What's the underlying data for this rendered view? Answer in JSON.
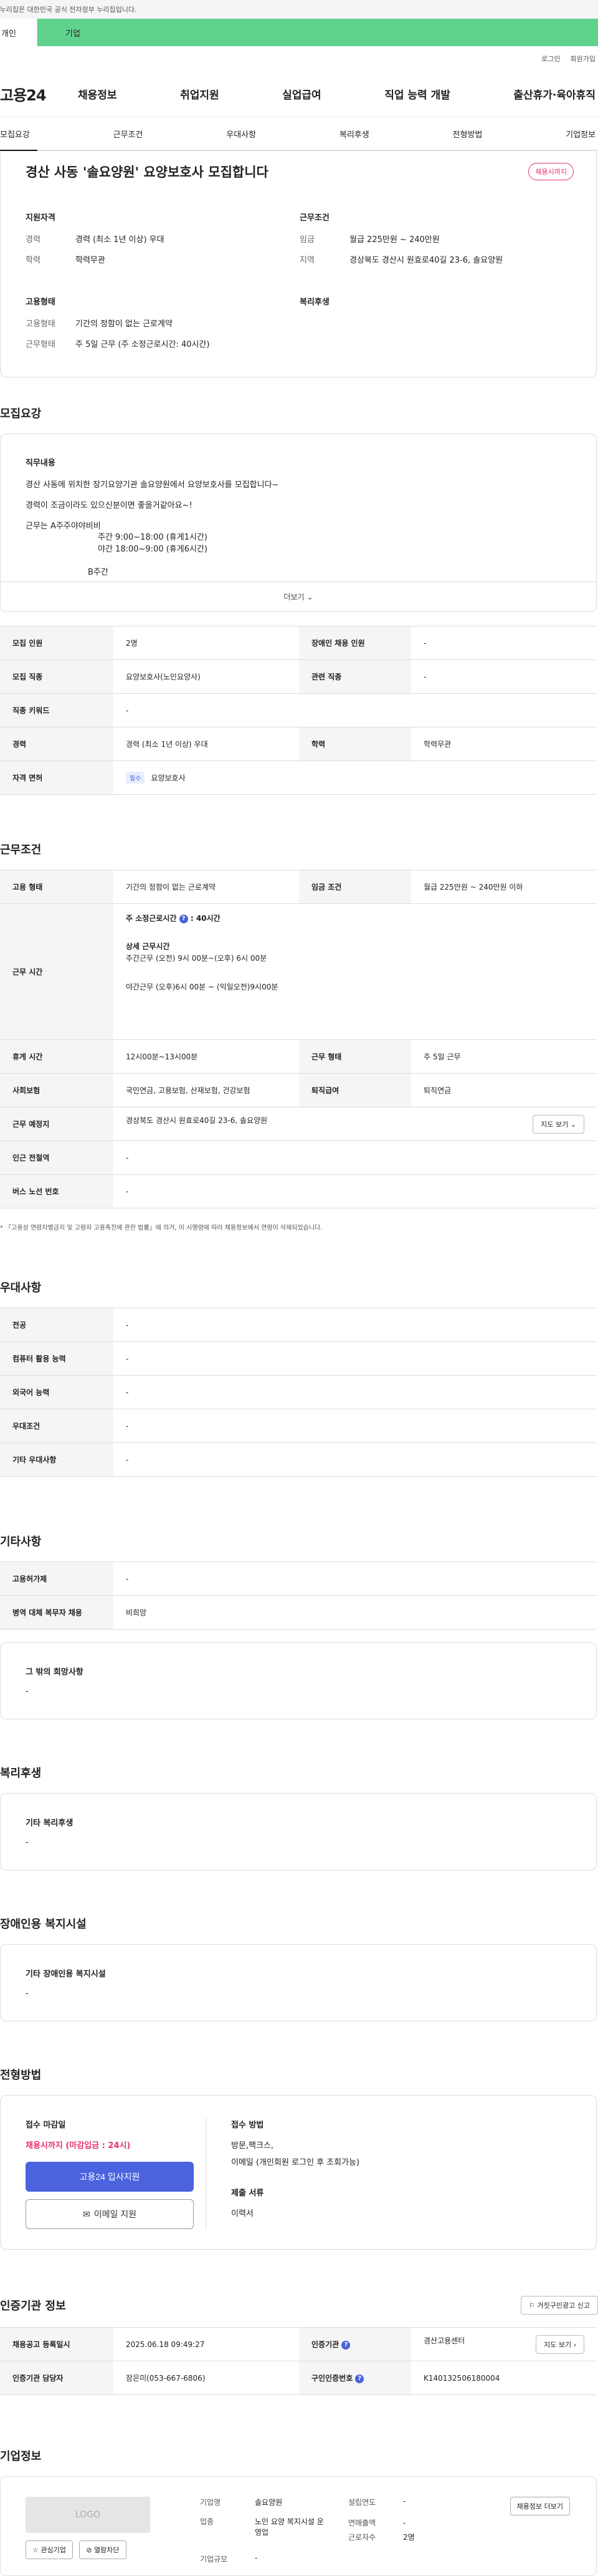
{
  "gov_banner": "이 누리집은 대한민국 공식 전자정부 누리집입니다.",
  "tabs": {
    "personal": "개인",
    "company": "기업"
  },
  "util": {
    "login": "로그인",
    "join": "회원가입"
  },
  "logo": "고용24",
  "gnb": [
    "채용정보",
    "취업지원",
    "실업급여",
    "직업 능력 개발",
    "출산휴가·육아휴직"
  ],
  "subnav": [
    "모집요강",
    "근무조건",
    "우대사항",
    "복리후생",
    "전형방법",
    "기업정보"
  ],
  "summary": {
    "title": "경산 사동 '솔요양원' 요양보호사 모집합니다",
    "badge": "채용시까지",
    "qual_title": "지원자격",
    "career_k": "경력",
    "career_v": "경력 (최소 1년 이상) 우대",
    "edu_k": "학력",
    "edu_v": "학력무관",
    "work_title": "근무조건",
    "wage_k": "임금",
    "wage_v": "월급 225만원 ~ 240만원",
    "area_k": "지역",
    "area_v": "경상북도 경산시 원효로40길 23-6, 솔요양원",
    "emp_title": "고용형태",
    "emptype_k": "고용형태",
    "emptype_v": "기간의 정함이 없는 근로계약",
    "worktype_k": "근무형태",
    "worktype_v": "주 5일 근무 (주 소정근로시간: 40시간)",
    "welfare_title": "복리후생"
  },
  "recruit": {
    "heading": "모집요강",
    "label": "직무내용",
    "line1": "경산 사동에 위치한   장기요양기관   솔요양원에서  요양보호사를 모집합니다~",
    "line2": "경력이 조금이라도 있으신분이면 좋을거같아요~!",
    "line3": "근무는    A주주야야비비",
    "line4": "주간 9:00~18:00 (휴게1시간)",
    "line5": "야간 18:00~9:00 (휴게6시간)",
    "line6": "B주간",
    "more": "더보기",
    "t_count_k": "모집 인원",
    "t_count_v": "2명",
    "t_disabled_k": "장애인 채용 인원",
    "t_disabled_v": "-",
    "t_job_k": "모집 직종",
    "t_job_v": "요양보호사(노인요양사)",
    "t_rel_k": "관련 직종",
    "t_rel_v": "-",
    "t_kw_k": "직종 키워드",
    "t_kw_v": "-",
    "t_career_k": "경력",
    "t_career_v": "경력 (최소 1년 이상) 우대",
    "t_edu_k": "학력",
    "t_edu_v": "학력무관",
    "t_lic_k": "자격 면허",
    "t_lic_chip": "필수",
    "t_lic_v": "요양보호사"
  },
  "cond": {
    "heading": "근무조건",
    "emp_k": "고용 형태",
    "emp_v": "기간의 정함이 없는 근로계약",
    "wage_k": "임금 조건",
    "wage_v": "월급 225만원 ~ 240만원 이하",
    "time_k": "근무 시간",
    "time_main": "주 소정근로시간",
    "time_hours": ": 40시간",
    "detail_title": "상세 근무시간",
    "detail1": "주간근무   (오전) 9시 00분~(오후) 6시 00분",
    "detail2": "야간근무 (오후)6시 00분 ~ (익일오전)9시00분",
    "rest_k": "휴게 시간",
    "rest_v": "12시00분~13시00분",
    "form_k": "근무 형태",
    "form_v": "주 5일 근무",
    "ins_k": "사회보험",
    "ins_v": "국민연금, 고용보험, 산재보험, 건강보험",
    "ret_k": "퇴직급여",
    "ret_v": "퇴직연금",
    "place_k": "근무 예정지",
    "place_v": "경상북도 경산시 원효로40길 23-6, 솔요양원",
    "map": "지도 보기",
    "sub_k": "인근 전철역",
    "sub_v": "-",
    "bus_k": "버스 노선 번호",
    "bus_v": "-",
    "note": "* 『고용상 연령차별금지 및 고령자 고용촉진에 관한 법률』에 의거, 이 시행령에 따라 채용정보에서 연령이 삭제되었습니다."
  },
  "pref": {
    "heading": "우대사항",
    "major_k": "전공",
    "major_v": "-",
    "pc_k": "컴퓨터 활용 능력",
    "pc_v": "-",
    "lang_k": "외국어 능력",
    "lang_v": "-",
    "cond_k": "우대조건",
    "cond_v": "-",
    "etc_k": "기타 우대사항",
    "etc_v": "-"
  },
  "other": {
    "heading": "기타사항",
    "dev_k": "고용허가제",
    "dev_v": "-",
    "mil_k": "병역 대체 복무자 채용",
    "mil_v": "비희망",
    "wish_t": "그 밖의 희망사항",
    "wish_v": "-"
  },
  "welfare": {
    "heading": "복리후생",
    "t": "기타 복리후생",
    "v": "-"
  },
  "disab": {
    "heading": "장애인용 복지시설",
    "t": "기타 장애인용 복지시설",
    "v": "-"
  },
  "apply": {
    "heading": "전형방법",
    "deadline_t": "접수 마감일",
    "deadline_v": "채용시까지 (마감입금 : 24시)",
    "apply_btn": "고용24 입사지원",
    "email_btn": "이메일 지원",
    "method_t": "접수 방법",
    "method_v1": "방문,팩크스,",
    "method_v2": "이메일 (개인회원 로그인 후 조회가능)",
    "docs_t": "제출 서류",
    "docs_v": "이력서"
  },
  "cert": {
    "heading": "인증기관 정보",
    "report": "거짓구인광고 신고",
    "reg_k": "채용공고 등록일시",
    "reg_v": "2025.06.18 09:49:27",
    "org_k": "인증기관",
    "org_v": "경산고용센터",
    "map": "지도 보기",
    "mgr_k": "인증기관 담당자",
    "mgr_v": "장은미(053-667-6806)",
    "no_k": "구인인증번호",
    "no_v": "K140132506180004"
  },
  "company": {
    "heading": "기업정보",
    "logo": "LOGO",
    "fav": "관심기업",
    "block": "열람차단",
    "name_k": "기업명",
    "name_v": "솔요양원",
    "est_k": "설립연도",
    "est_v": "-",
    "ind_k": "업종",
    "ind_v": "노인 요양 복지시설 운영업",
    "sales_k": "연매출액",
    "sales_v": "-",
    "emp_k": "근로자수",
    "emp_v": "2명",
    "size_k": "기업규모",
    "size_v": "-",
    "jobs_btn": "채용정보 더보기"
  }
}
